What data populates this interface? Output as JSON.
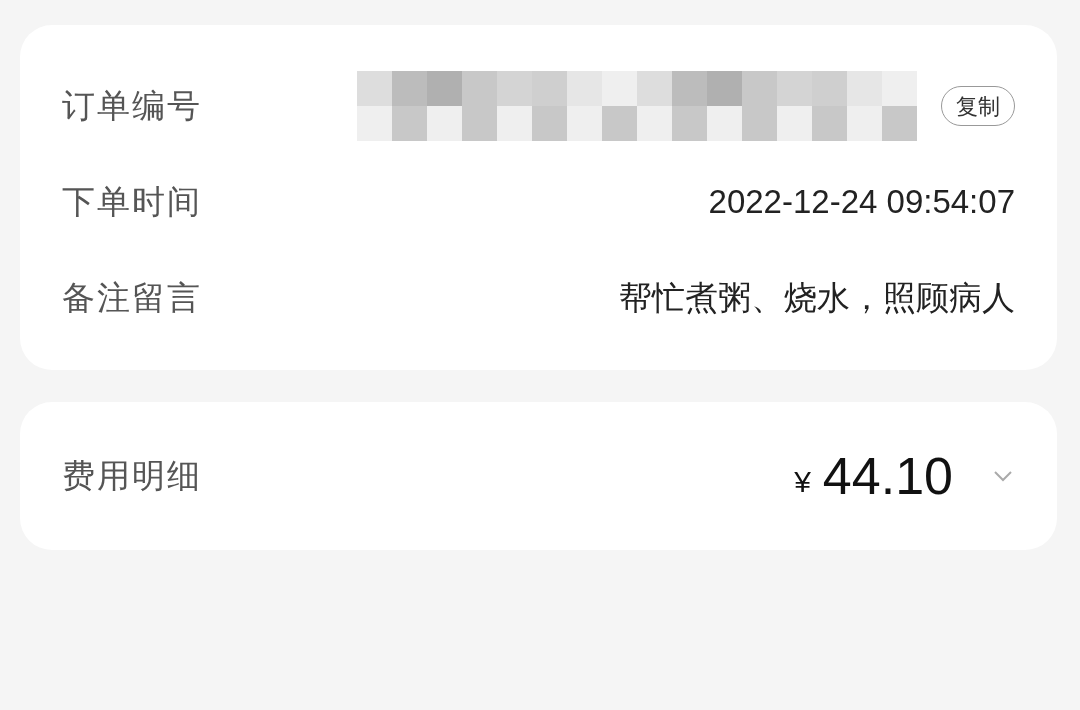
{
  "order_info": {
    "rows": [
      {
        "kind": "order_number",
        "label": "订单编号",
        "redacted": true,
        "action": "复制"
      },
      {
        "kind": "text",
        "label": "下单时间",
        "value": "2022-12-24 09:54:07"
      },
      {
        "kind": "text",
        "label": "备注留言",
        "value": "帮忙煮粥、烧水，照顾病人"
      }
    ]
  },
  "fee": {
    "label": "费用明细",
    "currency": "¥",
    "amount": "44.10",
    "expanded": false
  }
}
